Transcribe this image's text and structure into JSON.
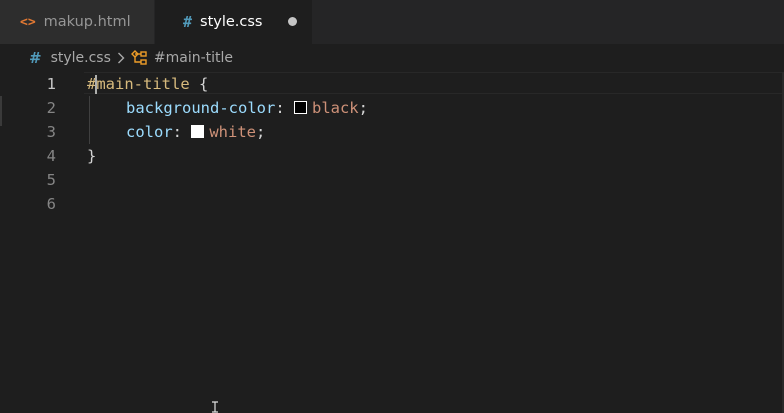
{
  "tabs": [
    {
      "label": "makup.html",
      "icon": "html-file-icon",
      "active": false
    },
    {
      "label": "style.css",
      "icon": "css-file-icon",
      "active": true,
      "dirty": true
    }
  ],
  "icons": {
    "html": "<>",
    "css": "#"
  },
  "breadcrumb": {
    "file": "style.css",
    "symbol": "#main-title"
  },
  "editor": {
    "lines": [
      {
        "number": "1",
        "selector_hash": "#",
        "selector_rest": "main-title",
        "brace": " {"
      },
      {
        "number": "2",
        "property": "background-color",
        "colon": ": ",
        "value": "black",
        "semi": ";",
        "swatch": "#000000"
      },
      {
        "number": "3",
        "property": "color",
        "colon": ": ",
        "value": "white",
        "semi": ";",
        "swatch": "#ffffff"
      },
      {
        "number": "4",
        "close": "}"
      },
      {
        "number": "5"
      },
      {
        "number": "6"
      }
    ]
  },
  "colors": {
    "background": "#1e1e1e",
    "tabbar": "#252526",
    "selector": "#d7ba7d",
    "property": "#9cdcfe",
    "value": "#ce9178"
  }
}
